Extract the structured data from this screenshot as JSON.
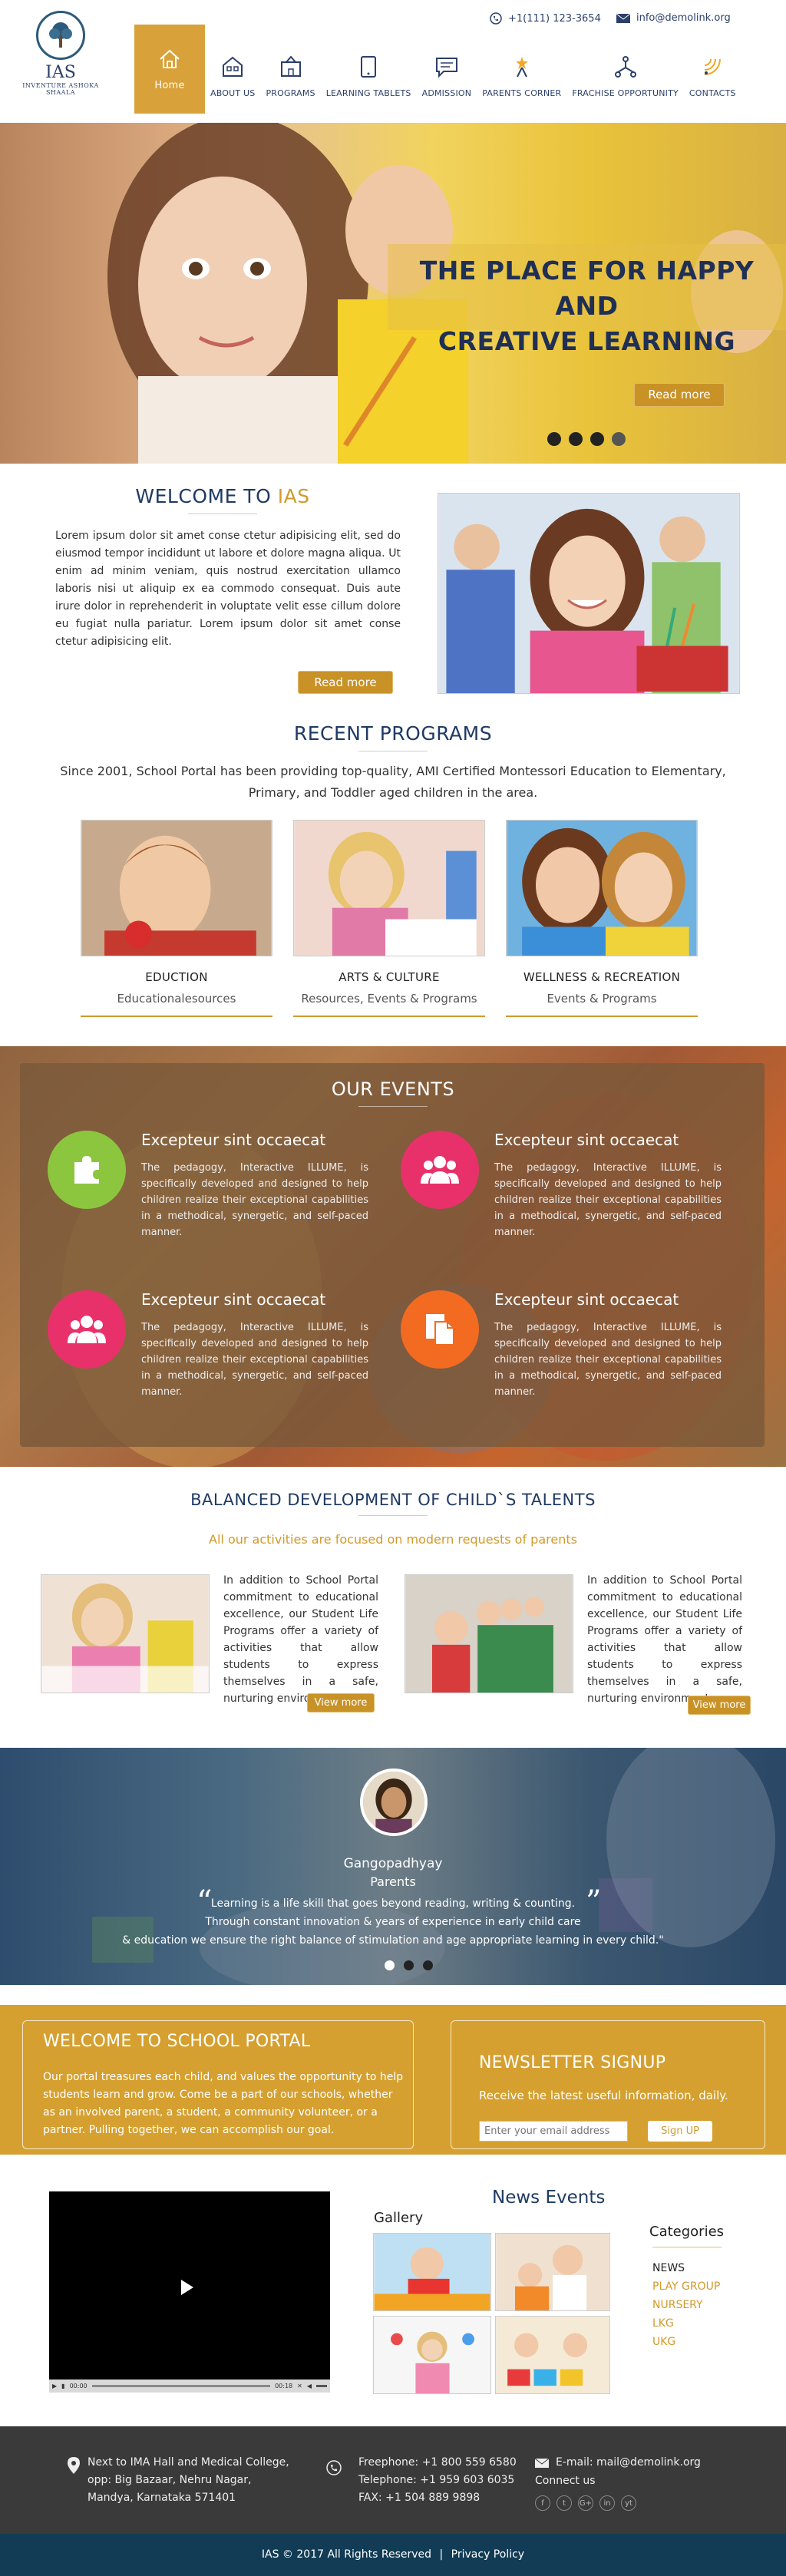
{
  "header": {
    "logo": {
      "title": "IAS",
      "subtitle": "INVENTURE ASHOKA SHAALA"
    },
    "phone": "+1(111) 123-3654",
    "email": "info@demolink.org",
    "nav": [
      {
        "label": "Home",
        "icon": "home-icon"
      },
      {
        "label": "ABOUT US",
        "icon": "building-icon"
      },
      {
        "label": "PROGRAMS",
        "icon": "school-icon"
      },
      {
        "label": "LEARNING TABLETS",
        "icon": "tablet-icon"
      },
      {
        "label": "ADMISSION",
        "icon": "chat-icon"
      },
      {
        "label": "PARENTS CORNER",
        "icon": "star-person-icon"
      },
      {
        "label": "FRACHISE OPPORTUNITY",
        "icon": "network-icon"
      },
      {
        "label": "CONTACTS",
        "icon": "signal-icon"
      }
    ]
  },
  "hero": {
    "line1": "THE PLACE FOR HAPPY AND",
    "line2": "CREATIVE LEARNING",
    "button": "Read more",
    "slides": 4,
    "active_slide": 3
  },
  "welcome": {
    "title_prefix": "WELCOME TO ",
    "title_accent": "IAS",
    "text": "Lorem ipsum dolor sit amet conse ctetur adipisicing elit, sed do eiusmod tempor incididunt ut labore et dolore magna aliqua. Ut enim ad minim veniam, quis nostrud exercitation ullamco laboris nisi ut aliquip ex ea commodo consequat. Duis aute irure dolor in reprehenderit in voluptate velit esse cillum dolore eu fugiat nulla pariatur. Lorem ipsum dolor sit amet conse ctetur adipisicing elit.",
    "button": "Read more"
  },
  "programs": {
    "title": "RECENT PROGRAMS",
    "intro": "Since 2001, School Portal has been providing top-quality, AMI Certified Montessori Education to Elementary, Primary, and Toddler aged children in the area.",
    "cards": [
      {
        "title": "EDUCTION",
        "subtitle": "Educationalesources"
      },
      {
        "title": "ARTS & CULTURE",
        "subtitle": "Resources, Events & Programs"
      },
      {
        "title": "WELLNESS & RECREATION",
        "subtitle": "Events & Programs"
      }
    ]
  },
  "events": {
    "title": "OUR EVENTS",
    "items": [
      {
        "title": "Excepteur sint occaecat",
        "text": "The pedagogy, Interactive ILLUME, is specifically developed and designed to help children realize their exceptional capabilities in a methodical, synergetic, and self-paced manner.",
        "icon": "puzzle-icon",
        "color": "#8cc63f"
      },
      {
        "title": "Excepteur sint occaecat",
        "text": "The pedagogy, Interactive ILLUME, is specifically developed and designed to help children realize their exceptional capabilities in a methodical, synergetic, and self-paced manner.",
        "icon": "group-icon",
        "color": "#e8316a"
      },
      {
        "title": "Excepteur sint occaecat",
        "text": "The pedagogy, Interactive ILLUME, is specifically developed and designed to help children realize their exceptional capabilities in a methodical, synergetic, and self-paced manner.",
        "icon": "group-icon",
        "color": "#e8316a"
      },
      {
        "title": "Excepteur sint occaecat",
        "text": "The pedagogy, Interactive ILLUME, is specifically developed and designed to help children realize their exceptional capabilities in a methodical, synergetic, and self-paced manner.",
        "icon": "document-icon",
        "color": "#f26b21"
      }
    ]
  },
  "balanced": {
    "title": "BALANCED DEVELOPMENT OF CHILD`S TALENTS",
    "subtitle": "All our activities are focused on modern requests of parents",
    "items": [
      {
        "text": "In addition to School Portal commitment to educational excellence, our Student Life Programs offer a variety of activities that allow students to express themselves in a safe, nurturing environment.",
        "button": "View more"
      },
      {
        "text": "In addition to School Portal commitment to educational excellence, our Student Life Programs offer a variety of activities that allow students to express themselves in a safe, nurturing environment.",
        "button": "View more"
      }
    ]
  },
  "testimonial": {
    "name": "Gangopadhyay",
    "role": "Parents",
    "line1": "Learning is a life skill that goes beyond reading, writing & counting.",
    "line2": "Through constant innovation & years of experience in early child care",
    "line3": "& education we ensure the right balance of stimulation and age appropriate learning in every child.\"",
    "slides": 3,
    "active_slide": 2
  },
  "portal": {
    "title": "WELCOME TO SCHOOL PORTAL",
    "text": "Our portal treasures each child, and values the opportunity to help students learn and grow. Come be a part of our schools, whether as an involved parent, a student, a community volunteer, or a partner. Pulling together, we can accomplish our goal.",
    "newsletter_title": "NEWSLETTER SIGNUP",
    "newsletter_text": "Receive the latest useful information, daily.",
    "email_placeholder": "Enter your email address",
    "signup_button": "Sign UP"
  },
  "media": {
    "video_time_left": "00:00",
    "video_time_right": "00:18",
    "gallery_title": "Gallery",
    "news_title": "News Events",
    "categories_title": "Categories",
    "categories": [
      "NEWS",
      "PLAY GROUP",
      "NURSERY",
      "LKG",
      "UKG"
    ]
  },
  "footer": {
    "address": [
      "Next to IMA Hall and Medical College,",
      "opp: Big Bazaar, Nehru Nagar,",
      "Mandya, Karnataka 571401"
    ],
    "freephone": "Freephone: +1 800 559 6580",
    "telephone": "Telephone: +1 959 603 6035",
    "fax": "FAX: +1 504 889 9898",
    "email": "E-mail: mail@demolink.org",
    "connect": "Connect us",
    "social": [
      "f",
      "t",
      "G+",
      "in",
      "yt"
    ],
    "copyright": "IAS © 2017 All Rights Reserved",
    "privacy": "Privacy Policy",
    "separator": "|"
  }
}
